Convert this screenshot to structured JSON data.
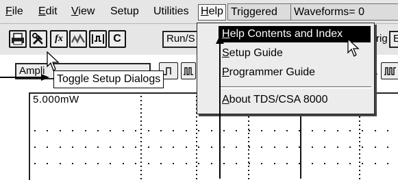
{
  "menubar": {
    "items": [
      {
        "label": "File",
        "underline": "F",
        "rest": "ile"
      },
      {
        "label": "Edit",
        "underline": "E",
        "rest": "dit"
      },
      {
        "label": "View",
        "underline": "V",
        "rest": "iew"
      },
      {
        "label": "Setup",
        "underline": "",
        "rest": "Setup"
      },
      {
        "label": "Utilities",
        "underline": "",
        "rest": "Utilities"
      },
      {
        "label": "Help",
        "underline": "H",
        "rest": "elp"
      }
    ],
    "status_trigger": "Triggered",
    "status_waveforms": "Waveforms= 0"
  },
  "toolbar": {
    "c_button_label": "C",
    "run_stop_label": "Run/S",
    "trig_label": "rig",
    "trig_value": "E",
    "measure_select_value": "Ampli",
    "fx_label": "fx"
  },
  "tooltip": {
    "text": "Toggle Setup Dialogs"
  },
  "help_menu": {
    "items": [
      {
        "label": "Help Contents and Index",
        "underline": "H",
        "rest": "elp Contents and Index"
      },
      {
        "label": "Setup Guide",
        "underline": "S",
        "rest": "etup Guide"
      },
      {
        "label": "Programmer Guide",
        "underline": "P",
        "rest": "rogrammer Guide"
      },
      {
        "label": "About TDS/CSA 8000",
        "underline": "A",
        "rest": "bout TDS/CSA 8000"
      }
    ]
  },
  "display": {
    "scale_label": "5.000mW"
  },
  "colors": {
    "menu_bg": "#e6e6e6",
    "selection": "#000000",
    "background": "#ffffff"
  }
}
